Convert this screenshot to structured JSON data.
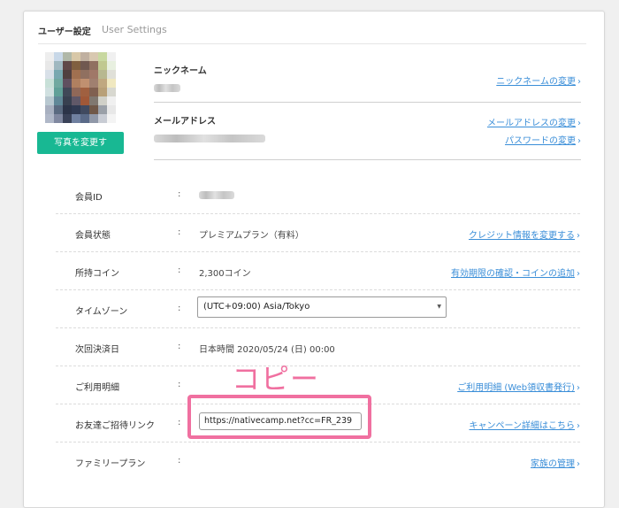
{
  "header": {
    "title_jp": "ユーザー設定",
    "title_en": "User Settings"
  },
  "avatar": {
    "colors": [
      "#eeeeee",
      "#c8d8e8",
      "#b0b8a8",
      "#d8c8a8",
      "#c0b0a0",
      "#d8c8b0",
      "#c8d8a0",
      "#f0f0f0",
      "#e8e8e8",
      "#a0b8c0",
      "#604848",
      "#806040",
      "#705850",
      "#907060",
      "#c0c890",
      "#e8f0e0",
      "#d8e0e8",
      "#78a8b0",
      "#504040",
      "#a07050",
      "#907060",
      "#a07868",
      "#b8b890",
      "#e0e0d8",
      "#c8e0d8",
      "#70a8a0",
      "#605060",
      "#b08060",
      "#c09070",
      "#a08070",
      "#c0a880",
      "#f0e8c0",
      "#d0e0e0",
      "#60a098",
      "#404858",
      "#906858",
      "#a06040",
      "#806050",
      "#b8a078",
      "#d8d8d0",
      "#b8c8d0",
      "#608898",
      "#384050",
      "#605868",
      "#a05838",
      "#807870",
      "#d0d0c8",
      "#f0f0f0",
      "#a8b0c0",
      "#5a6a80",
      "#2c3448",
      "#303a52",
      "#404a60",
      "#705848",
      "#9aa0a8",
      "#e8e8e8",
      "#b0b8c8",
      "#8088a0",
      "#3a4258",
      "#7080a0",
      "#5a6a88",
      "#9098a8",
      "#c8ccd4",
      "#f4f4f4"
    ]
  },
  "photo_button": "写真を変更す",
  "profile": {
    "nickname": {
      "label": "ニックネーム",
      "link": "ニックネームの変更"
    },
    "email": {
      "label": "メールアドレス",
      "link": "メールアドレスの変更",
      "link2": "パスワードの変更"
    }
  },
  "rows": {
    "member_id": {
      "label": "会員ID",
      "colon": ":"
    },
    "status": {
      "label": "会員状態",
      "colon": ":",
      "value": "プレミアムプラン（有料）",
      "link": "クレジット情報を変更する"
    },
    "coins": {
      "label": "所持コイン",
      "colon": ":",
      "value": "2,300コイン",
      "link": "有効期限の確認・コインの追加"
    },
    "timezone": {
      "label": "タイムゾーン",
      "colon": ":",
      "value": "(UTC+09:00) Asia/Tokyo"
    },
    "next_payment": {
      "label": "次回決済日",
      "colon": ":",
      "value": "日本時間 2020/05/24 (日) 00:00"
    },
    "usage": {
      "label": "ご利用明細",
      "colon": ":",
      "link": "ご利用明細 (Web領収書発行)"
    },
    "referral": {
      "label": "お友達ご招待リンク",
      "colon": ":",
      "value": "https://nativecamp.net?cc=FR_239",
      "link": "キャンペーン詳細はこちら"
    },
    "family": {
      "label": "ファミリープラン",
      "colon": ":",
      "link": "家族の管理"
    }
  },
  "annotation": {
    "text": "コピー",
    "color": "#f070a0"
  },
  "colors": {
    "accent_green": "#18b893",
    "link_blue": "#3a8ed8"
  },
  "chevron": "›",
  "select_arrow": "▼"
}
